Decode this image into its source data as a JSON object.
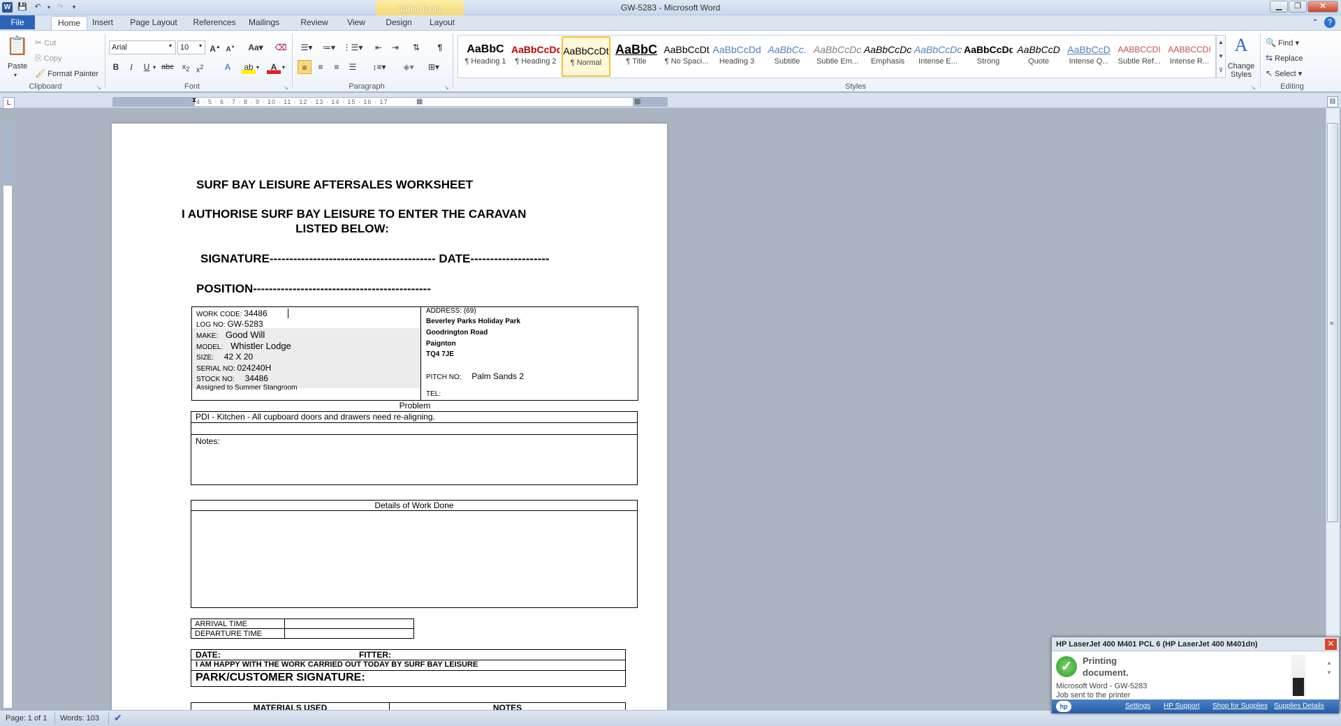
{
  "window": {
    "title": "GW-5283  -  Microsoft Word",
    "contextual_tab_group": "Table Tools"
  },
  "tabs": {
    "file": "File",
    "items": [
      "Home",
      "Insert",
      "Page Layout",
      "References",
      "Mailings",
      "Review",
      "View",
      "Design",
      "Layout"
    ],
    "active": "Home"
  },
  "ribbon": {
    "clipboard": {
      "label": "Clipboard",
      "paste": "Paste",
      "cut": "Cut",
      "copy": "Copy",
      "format_painter": "Format Painter"
    },
    "font": {
      "label": "Font",
      "font_name": "Arial",
      "font_size": "10"
    },
    "paragraph": {
      "label": "Paragraph"
    },
    "styles": {
      "label": "Styles",
      "change_styles": "Change Styles",
      "items": [
        {
          "preview": "AaBbC",
          "name": "¶ Heading 1",
          "color": "#000000"
        },
        {
          "preview": "AaBbCcDd",
          "name": "¶ Heading 2",
          "color": "#c00000"
        },
        {
          "preview": "AaBbCcDt",
          "name": "¶ Normal",
          "color": "#000000"
        },
        {
          "preview": "AaBbC",
          "name": "¶ Title",
          "color": "#000000"
        },
        {
          "preview": "AaBbCcDt",
          "name": "¶ No Spaci...",
          "color": "#000000"
        },
        {
          "preview": "AaBbCcDd",
          "name": "Heading 3",
          "color": "#4f81bd"
        },
        {
          "preview": "AaBbCc.",
          "name": "Subtitle",
          "color": "#4f81bd"
        },
        {
          "preview": "AaBbCcDc",
          "name": "Subtle Em...",
          "color": "#808080"
        },
        {
          "preview": "AaBbCcDc",
          "name": "Emphasis",
          "color": "#000000"
        },
        {
          "preview": "AaBbCcDc",
          "name": "Intense E...",
          "color": "#4f81bd"
        },
        {
          "preview": "AaBbCcDd",
          "name": "Strong",
          "color": "#000000"
        },
        {
          "preview": "AaBbCcD",
          "name": "Quote",
          "color": "#000000"
        },
        {
          "preview": "AaBbCcD",
          "name": "Intense Q...",
          "color": "#4f81bd"
        },
        {
          "preview": "AABBCCDI",
          "name": "Subtle Ref...",
          "color": "#c0504d"
        },
        {
          "preview": "AABBCCDI",
          "name": "Intense R...",
          "color": "#c0504d"
        }
      ]
    },
    "editing": {
      "label": "Editing",
      "find": "Find",
      "replace": "Replace",
      "select": "Select"
    }
  },
  "ruler": {
    "marks": "3 · 2 · 1 · 1 · 1 · 2 · 3 · 4 · 5 · 6 · 7 · 8 · 9 · 10 · 11 · 12 · 13 · 14 · 15 · 16 · 17"
  },
  "document": {
    "heading": "SURF BAY LEISURE AFTERSALES WORKSHEET",
    "authorise_line1": "I AUTHORISE SURF BAY LEISURE TO ENTER THE CARAVAN",
    "authorise_line2": "LISTED BELOW:",
    "signature_line": "SIGNATURE------------------------------------------ DATE--------------------",
    "position_line": "POSITION---------------------------------------------",
    "info": {
      "work_code_label": "WORK CODE:",
      "work_code": "34486",
      "log_no_label": "LOG NO:",
      "log_no": "GW-5283",
      "make_label": "MAKE:",
      "make": "Good Will",
      "model_label": "MODEL:",
      "model": "Whistler Lodge",
      "size_label": "SIZE:",
      "size": "42 X 20",
      "serial_label": "SERIAL NO:",
      "serial": "024240H",
      "stock_label": "STOCK NO:",
      "stock": "34486",
      "assigned": "Assigned to Summer Stangroom",
      "address_label": "ADDRESS:",
      "address_num": "(69)",
      "address_line1": "Beverley Parks Holiday Park",
      "address_line2": "Goodrington Road",
      "address_line3": "Paignton",
      "address_line4": "TQ4 7JE",
      "pitch_label": "PITCH NO:",
      "pitch": "Palm Sands 2",
      "tel_label": "TEL:"
    },
    "problem_label": "Problem",
    "problem_text": "PDI - Kitchen - All cupboard doors and drawers need re-aligning.",
    "notes_label": "Notes:",
    "work_done_label": "Details of Work Done",
    "arrival_label": "ARRIVAL  TIME",
    "departure_label": "DEPARTURE  TIME",
    "date_label": "DATE:",
    "fitter_label": "FITTER:",
    "happy_line": "I AM HAPPY WITH THE WORK CARRIED OUT TODAY BY SURF BAY LEISURE",
    "customer_sig": "PARK/CUSTOMER SIGNATURE:",
    "materials_label": "MATERIALS USED",
    "notes_col_label": "NOTES"
  },
  "statusbar": {
    "page": "Page: 1 of 1",
    "words": "Words: 103"
  },
  "printer": {
    "title": "HP LaserJet 400 M401 PCL 6 (HP LaserJet 400 M401dn)",
    "status_line1": "Printing",
    "status_line2": "document.",
    "job_line1": "Microsoft Word - GW-5283",
    "job_line2": "Job sent to the printer",
    "footer_links": [
      "Settings",
      "HP Support",
      "Shop for Supplies",
      "Supplies Details"
    ]
  }
}
